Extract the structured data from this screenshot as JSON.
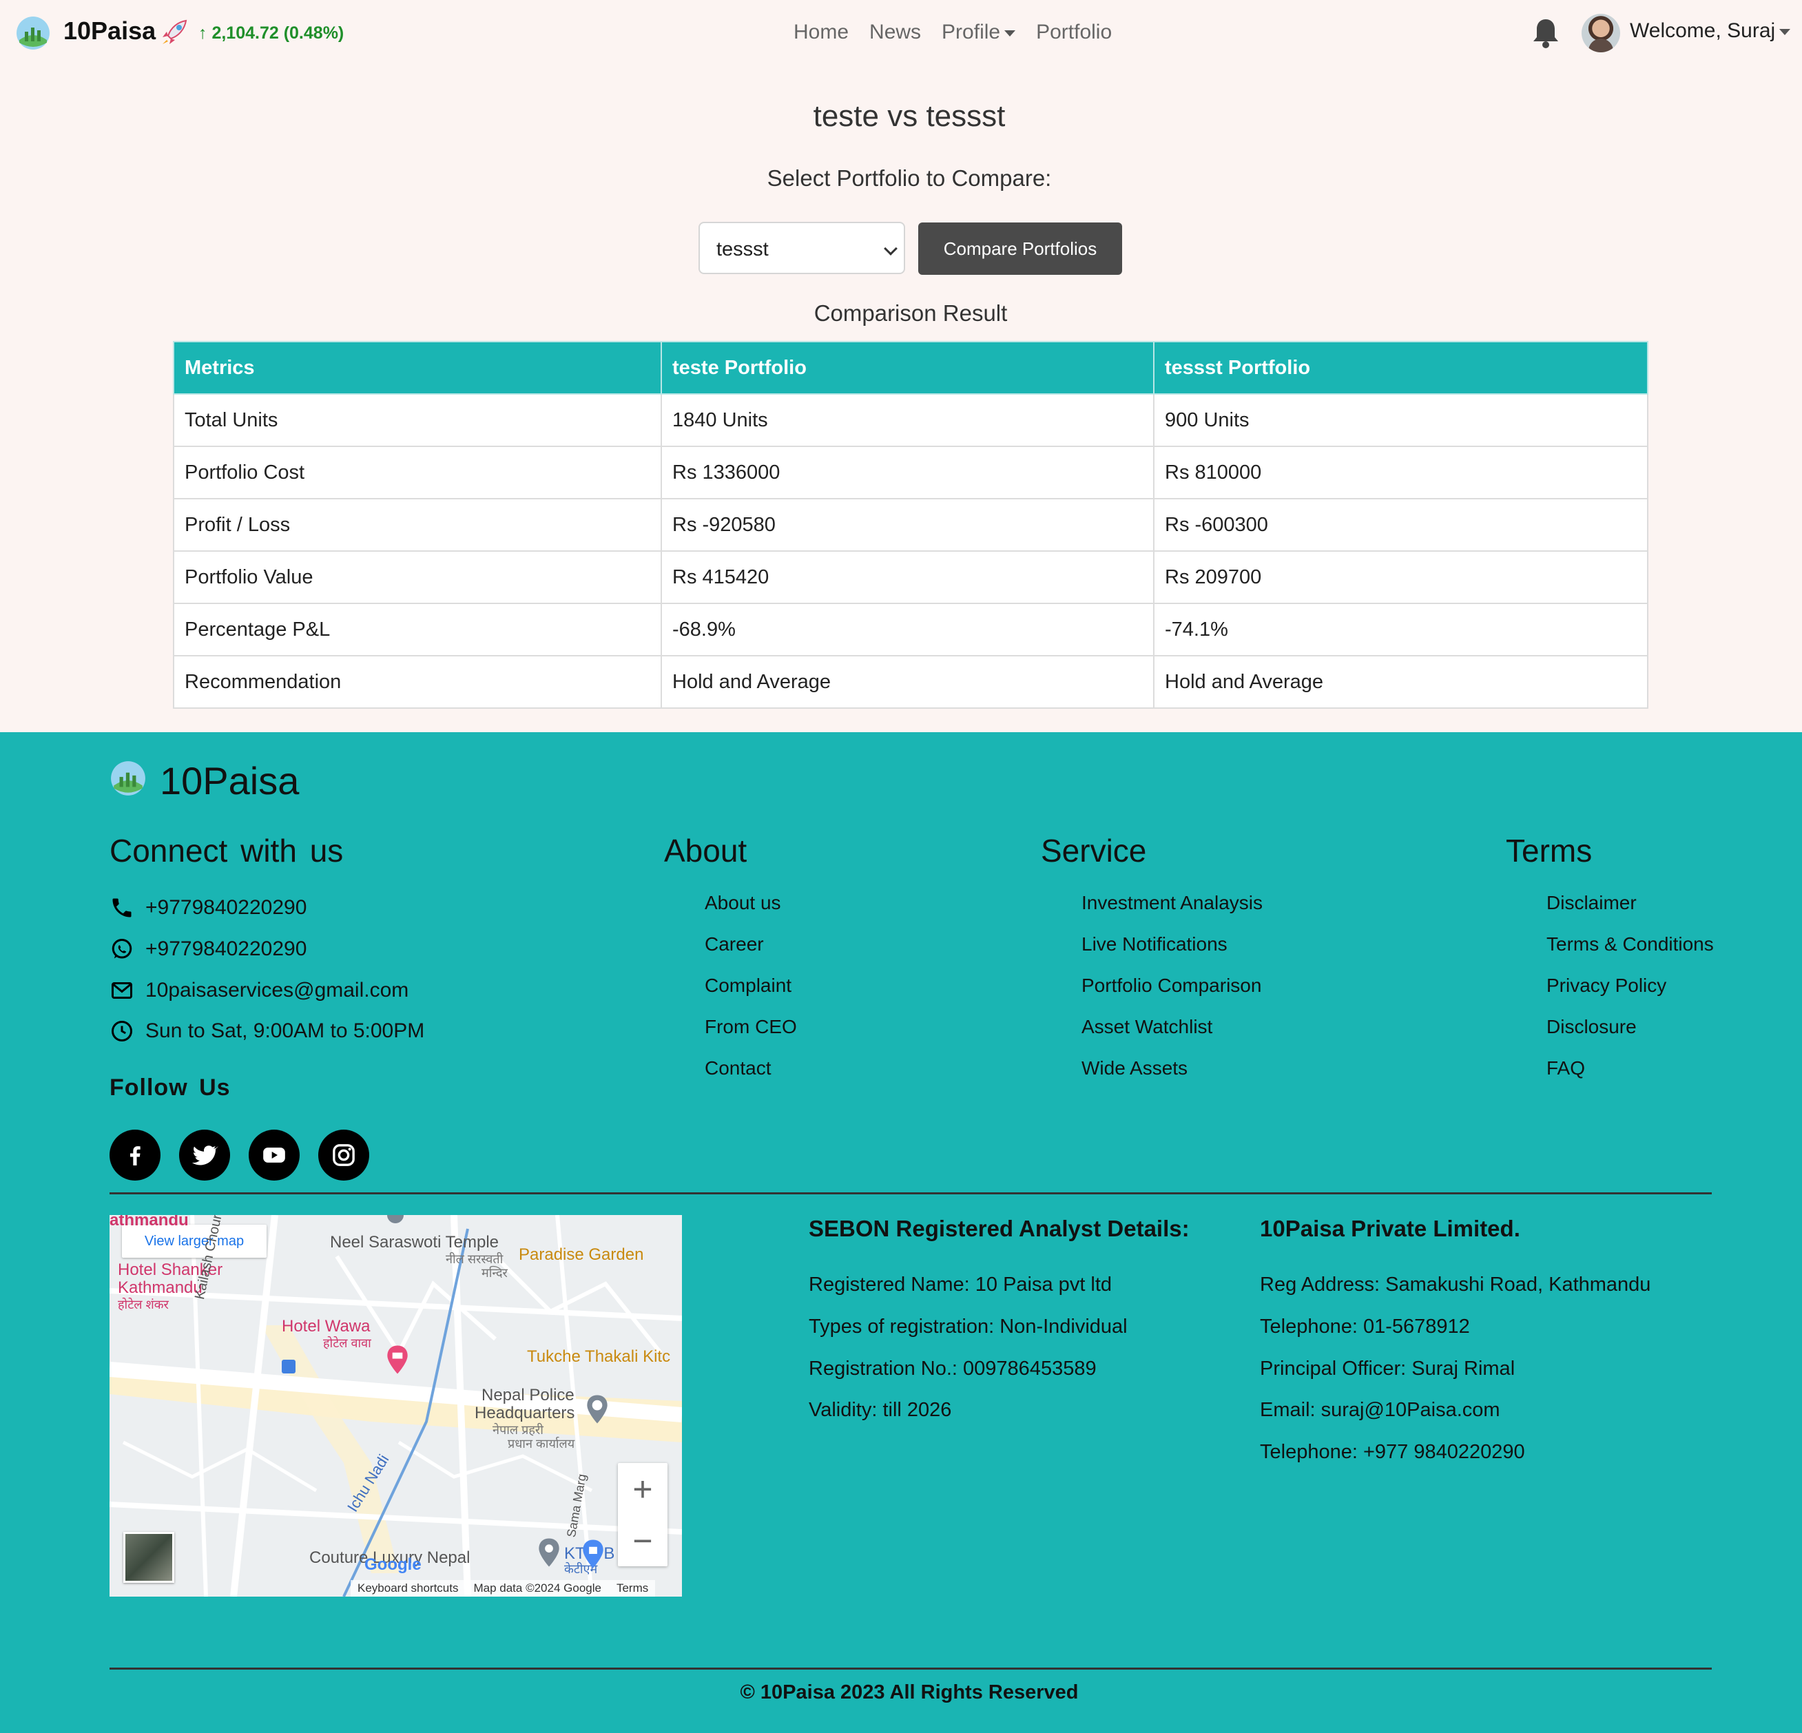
{
  "navbar": {
    "brand": "10Paisa",
    "ticker": "↑ 2,104.72 (0.48%)",
    "links": [
      "Home",
      "News",
      "Profile",
      "Portfolio"
    ],
    "welcome": "Welcome, Suraj",
    "icons": [
      "logo-icon",
      "rocket-icon",
      "bell-icon",
      "avatar"
    ]
  },
  "main": {
    "title": "teste vs tessst",
    "select_label": "Select Portfolio to Compare:",
    "selected_portfolio": "tessst",
    "compare_button": "Compare Portfolios",
    "result_title": "Comparison Result",
    "table": {
      "headers": [
        "Metrics",
        "teste Portfolio",
        "tessst Portfolio"
      ],
      "rows": [
        [
          "Total Units",
          "1840 Units",
          "900 Units"
        ],
        [
          "Portfolio Cost",
          "Rs 1336000",
          "Rs 810000"
        ],
        [
          "Profit / Loss",
          "Rs -920580",
          "Rs -600300"
        ],
        [
          "Portfolio Value",
          "Rs 415420",
          "Rs 209700"
        ],
        [
          "Percentage P&L",
          "-68.9%",
          "-74.1%"
        ],
        [
          "Recommendation",
          "Hold and Average",
          "Hold and Average"
        ]
      ]
    }
  },
  "footer": {
    "brand": "10Paisa",
    "connect_title": "Connect  with  us",
    "contacts": {
      "phone": "+9779840220290",
      "whatsapp": "+9779840220290",
      "email": "10paisaservices@gmail.com",
      "hours": "Sun to Sat, 9:00AM to 5:00PM"
    },
    "follow_title": "Follow  Us",
    "social": [
      "facebook-icon",
      "twitter-icon",
      "youtube-icon",
      "instagram-icon"
    ],
    "about": {
      "title": "About",
      "links": [
        "About us",
        "Career",
        "Complaint",
        "From CEO",
        "Contact"
      ]
    },
    "service": {
      "title": "Service",
      "links": [
        "Investment Analaysis",
        "Live Notifications",
        "Portfolio Comparison",
        "Asset Watchlist",
        "Wide Assets"
      ]
    },
    "terms": {
      "title": "Terms",
      "links": [
        "Disclaimer",
        "Terms & Conditions",
        "Privacy Policy",
        "Disclosure",
        "FAQ"
      ]
    },
    "map": {
      "view_larger": "View larger map",
      "labels": {
        "kathmandu_top": "athmandu",
        "neel": "Neel Saraswoti Temple",
        "neel_np": "नील सरस्वती",
        "neel_np2": "मन्दिर",
        "paradise": "Paradise Garden",
        "shanker1": "Hotel Shanker",
        "shanker2": "Kathmandu",
        "shanker_np": "होटेल शंकर",
        "chour": "Kailash Chour Marga",
        "wawa": "Hotel Wawa",
        "wawa_np": "होटेल वावा",
        "tukche": "Tukche Thakali Kitc",
        "police1": "Nepal Police",
        "police2": "Headquarters",
        "police_np1": "नेपाल प्रहरी",
        "police_np2": "प्रधान कार्यालय",
        "ichu": "Ichu Nadi",
        "sama": "Sama Marg",
        "couture": "Couture Luxury Nepal",
        "ktm": "KTM B",
        "ktm_np": "केटीएम",
        "google": "Google"
      },
      "attribution": [
        "Keyboard shortcuts",
        "Map data ©2024 Google",
        "Terms"
      ],
      "zoom_in": "+",
      "zoom_out": "−"
    },
    "sebon": {
      "title": "SEBON Registered Analyst Details:",
      "lines": [
        "Registered Name: 10 Paisa pvt ltd",
        "Types of registration: Non-Individual",
        "Registration No.: 009786453589",
        "Validity: till 2026"
      ]
    },
    "company": {
      "title": "10Paisa Private Limited.",
      "lines": [
        "Reg Address: Samakushi Road, Kathmandu",
        "Telephone: 01-5678912",
        "Principal Officer: Suraj Rimal",
        "Email: suraj@10Paisa.com",
        "Telephone: +977 9840220290"
      ]
    },
    "copyright": "© 10Paisa 2023 All Rights Reserved"
  },
  "colors": {
    "teal": "#1ab5b3",
    "page_bg": "#fcf4f2",
    "ticker_green": "#1f8f2a",
    "button_dark": "#4a4a4a"
  }
}
